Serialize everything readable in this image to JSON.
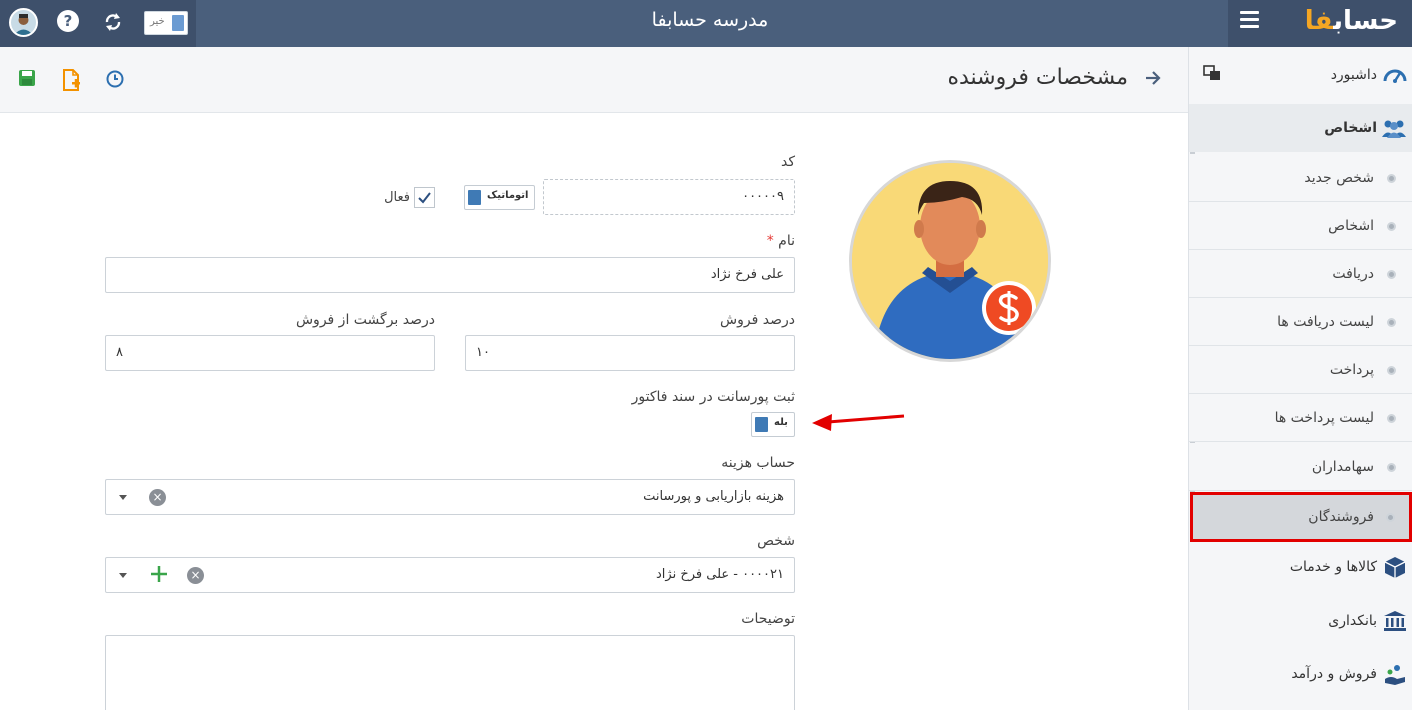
{
  "topbar": {
    "company_name": "مدرسه حسابفا",
    "logo_text_main": "حساب",
    "logo_text_accent": "فا",
    "toggle_label": "خیر"
  },
  "header": {
    "title": "مشخصات فروشنده"
  },
  "sidebar": {
    "items": [
      {
        "label": "داشبورد",
        "icon": "dashboard-icon"
      },
      {
        "label": "اشخاص",
        "icon": "people-icon"
      },
      {
        "label": "شخص جدید"
      },
      {
        "label": "اشخاص"
      },
      {
        "label": "دریافت"
      },
      {
        "label": "لیست دریافت ها"
      },
      {
        "label": "پرداخت"
      },
      {
        "label": "لیست پرداخت ها"
      },
      {
        "label": "سهامداران"
      },
      {
        "label": "فروشندگان"
      },
      {
        "label": "کالاها و خدمات",
        "icon": "box-icon"
      },
      {
        "label": "بانکداری",
        "icon": "bank-icon"
      },
      {
        "label": "فروش و درآمد",
        "icon": "sales-icon"
      }
    ]
  },
  "form": {
    "code_label": "کد",
    "code_value": "۰۰۰۰۰۹",
    "auto_label": "اتوماتیک",
    "active_label": "فعال",
    "name_label": "نام",
    "required_mark": "*",
    "name_value": "علی فرخ نژاد",
    "sales_percent_label": "درصد فروش",
    "sales_percent_value": "۱۰",
    "return_percent_label": "درصد برگشت از فروش",
    "return_percent_value": "۸",
    "commission_label": "ثبت پورسانت در سند فاکتور",
    "commission_toggle": "بله",
    "expense_label": "حساب هزینه",
    "expense_value": "هزینه بازاریابی و پورسانت",
    "person_label": "شخص",
    "person_value": "۰۰۰۰۲۱ - علی فرخ نژاد",
    "notes_label": "توضیحات"
  },
  "colors": {
    "topbar": "#4a5f7c",
    "accent": "#f5a623",
    "highlight": "#e20000",
    "toggle_blue": "#3f7ab5"
  }
}
